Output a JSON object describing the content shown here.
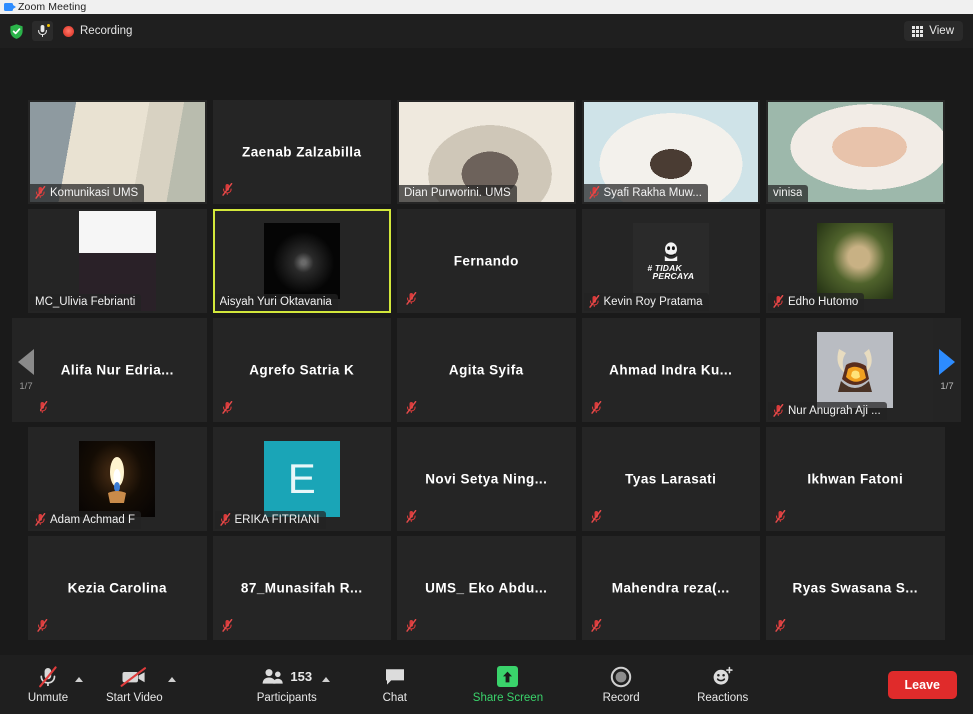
{
  "window": {
    "title": "Zoom Meeting",
    "app_icon": "zoom-camera-icon"
  },
  "topbar": {
    "encryption_icon": "shield-check-icon",
    "mic_icon": "microphone-icon",
    "recording_icon": "recording-dot-icon",
    "recording_label": "Recording",
    "view_icon": "grid-icon",
    "view_label": "View"
  },
  "gallery": {
    "prev_page": {
      "icon": "triangle-left-icon",
      "page_label": "1/7"
    },
    "next_page": {
      "icon": "triangle-right-icon",
      "page_label": "1/7"
    },
    "active_tile_border_color": "#d3e83b",
    "participants": [
      {
        "name": "Komunikasi UMS",
        "muted": true,
        "video": true,
        "media": "full",
        "name_style": "bar",
        "active": false
      },
      {
        "name": "Zaenab Zalzabilla",
        "muted": true,
        "video": false,
        "media": "none",
        "name_style": "center",
        "active": false
      },
      {
        "name": "Dian Purworini. UMS",
        "muted": false,
        "video": true,
        "media": "full",
        "name_style": "bar",
        "active": false
      },
      {
        "name": "Syafi Rakha Muw...",
        "muted": true,
        "video": true,
        "media": "full",
        "name_style": "bar",
        "active": false
      },
      {
        "name": "vinisa",
        "muted": false,
        "video": true,
        "media": "full",
        "name_style": "bar",
        "active": false
      },
      {
        "name": "MC_Ulivia Febrianti",
        "muted": false,
        "video": true,
        "media": "portrait",
        "name_style": "bar",
        "active": false
      },
      {
        "name": "Aisyah Yuri Oktavania",
        "muted": false,
        "video": true,
        "media": "square",
        "name_style": "bar",
        "active": true
      },
      {
        "name": "Fernando",
        "muted": true,
        "video": false,
        "media": "none",
        "name_style": "center",
        "active": false
      },
      {
        "name": "Kevin Roy Pratama",
        "muted": true,
        "video": true,
        "media": "avatar-tidak-percaya",
        "name_style": "bar",
        "active": false
      },
      {
        "name": "Edho Hutomo",
        "muted": true,
        "video": true,
        "media": "square",
        "name_style": "bar",
        "active": false
      },
      {
        "name": "Alifa Nur Edria...",
        "muted": true,
        "video": false,
        "media": "none",
        "name_style": "center",
        "active": false
      },
      {
        "name": "Agrefo Satria K",
        "muted": true,
        "video": false,
        "media": "none",
        "name_style": "center",
        "active": false
      },
      {
        "name": "Agita Syifa",
        "muted": true,
        "video": false,
        "media": "none",
        "name_style": "center",
        "active": false
      },
      {
        "name": "Ahmad Indra Ku...",
        "muted": true,
        "video": false,
        "media": "none",
        "name_style": "center",
        "active": false
      },
      {
        "name": "Nur Anugrah Aji ...",
        "muted": true,
        "video": true,
        "media": "avatar-dragon",
        "name_style": "bar",
        "active": false
      },
      {
        "name": "Adam Achmad F",
        "muted": true,
        "video": true,
        "media": "avatar-candle",
        "name_style": "bar",
        "active": false
      },
      {
        "name": "ERIKA FITRIANI",
        "muted": true,
        "video": true,
        "media": "avatar-letter",
        "avatar_letter": "E",
        "avatar_color": "#1aa5b7",
        "name_style": "bar",
        "active": false
      },
      {
        "name": "Novi Setya Ning...",
        "muted": true,
        "video": false,
        "media": "none",
        "name_style": "center",
        "active": false
      },
      {
        "name": "Tyas Larasati",
        "muted": true,
        "video": false,
        "media": "none",
        "name_style": "center",
        "active": false
      },
      {
        "name": "Ikhwan Fatoni",
        "muted": true,
        "video": false,
        "media": "none",
        "name_style": "center",
        "active": false
      },
      {
        "name": "Kezia Carolina",
        "muted": true,
        "video": false,
        "media": "none",
        "name_style": "center",
        "active": false
      },
      {
        "name": "87_Munasifah R...",
        "muted": true,
        "video": false,
        "media": "none",
        "name_style": "center",
        "active": false
      },
      {
        "name": "UMS_ Eko Abdu...",
        "muted": true,
        "video": false,
        "media": "none",
        "name_style": "center",
        "active": false
      },
      {
        "name": "Mahendra  reza(...",
        "muted": true,
        "video": false,
        "media": "none",
        "name_style": "center",
        "active": false
      },
      {
        "name": "Ryas Swasana S...",
        "muted": true,
        "video": false,
        "media": "none",
        "name_style": "center",
        "active": false
      }
    ]
  },
  "toolbar": {
    "audio": {
      "icon": "microphone-muted-icon",
      "label": "Unmute",
      "has_caret": true
    },
    "video": {
      "icon": "camera-off-icon",
      "label": "Start Video",
      "has_caret": true
    },
    "participants": {
      "icon": "people-icon",
      "label": "Participants",
      "count": "153",
      "has_caret": true
    },
    "chat": {
      "icon": "chat-bubble-icon",
      "label": "Chat",
      "has_caret": false
    },
    "share": {
      "icon": "share-screen-icon",
      "label": "Share Screen",
      "has_caret": false,
      "accent": "#3ad36b"
    },
    "record": {
      "icon": "record-circle-icon",
      "label": "Record",
      "has_caret": false
    },
    "reactions": {
      "icon": "smiley-plus-icon",
      "label": "Reactions",
      "has_caret": false
    },
    "leave": {
      "label": "Leave",
      "color": "#e02b2b"
    }
  }
}
